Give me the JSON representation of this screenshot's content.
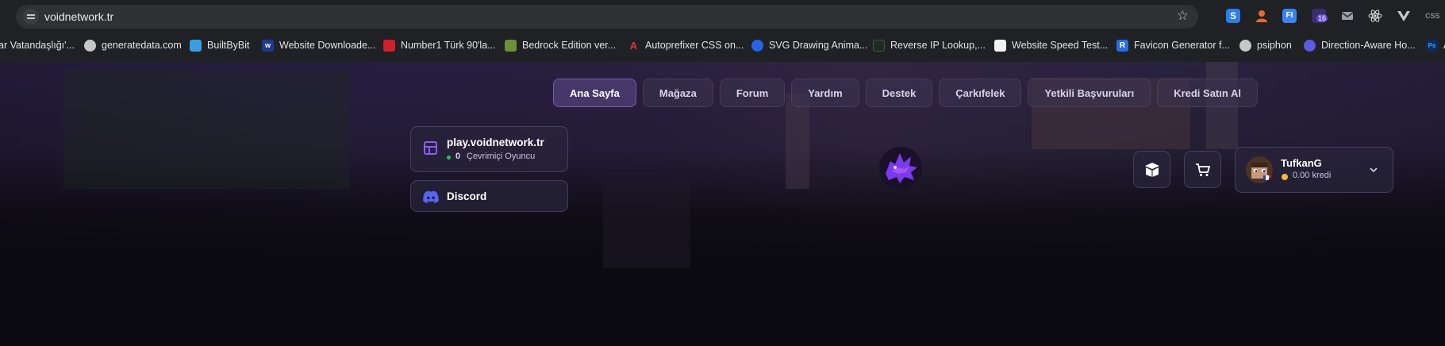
{
  "browser": {
    "url": "voidnetwork.tr",
    "extension_badge": "16",
    "extensions": [
      {
        "icon": "s-extension-icon",
        "color": "#2b7de9"
      },
      {
        "icon": "user-extension-icon",
        "color": "#e86b2e"
      },
      {
        "icon": "font-extension-icon",
        "color": "#3b82f6"
      },
      {
        "icon": "badge-extension-icon",
        "color": "#6d4bd8"
      },
      {
        "icon": "mail-extension-icon",
        "color": "#9aa0a6"
      },
      {
        "icon": "react-extension-icon",
        "color": "#e3e3e3"
      },
      {
        "icon": "vue-extension-icon",
        "color": "#c7c7c7"
      },
      {
        "icon": "css-extension-icon",
        "color": "#8a8a8a"
      }
    ],
    "bookmarks": [
      {
        "label": "ar Vatandaşlığı'...",
        "icon": "globe-icon",
        "color": "#8a8a8a"
      },
      {
        "label": "generatedata.com",
        "icon": "globe-icon",
        "color": "#c7c7c7"
      },
      {
        "label": "BuiltByBit",
        "icon": "cube-icon",
        "color": "#3b9ce0"
      },
      {
        "label": "Website Downloade...",
        "icon": "w-icon",
        "color": "#1e3a8a"
      },
      {
        "label": "Number1 Türk 90'la...",
        "icon": "radio-icon",
        "color": "#d0202a"
      },
      {
        "label": "Bedrock Edition ver...",
        "icon": "block-icon",
        "color": "#6b8f3a"
      },
      {
        "label": "Autoprefixer CSS on...",
        "icon": "autoprefixer-icon",
        "color": "#dd3735"
      },
      {
        "label": "SVG Drawing Anima...",
        "icon": "drop-icon",
        "color": "#2563eb"
      },
      {
        "label": "Reverse IP Lookup,...",
        "icon": "terminal-icon",
        "color": "#1f2a24"
      },
      {
        "label": "Website Speed Test...",
        "icon": "speed-icon",
        "color": "#f2f2f2"
      },
      {
        "label": "Favicon Generator f...",
        "icon": "r-icon",
        "color": "#2b6de0"
      },
      {
        "label": "psiphon",
        "icon": "globe-icon",
        "color": "#c7c7c7"
      },
      {
        "label": "Direction-Aware Ho...",
        "icon": "codepen-icon",
        "color": "#5b5be0"
      },
      {
        "label": "A",
        "icon": "ps-icon",
        "color": "#0f2a57"
      }
    ]
  },
  "nav": {
    "items": [
      "Ana Sayfa",
      "Mağaza",
      "Forum",
      "Yardım",
      "Destek",
      "Çarkıfelek",
      "Yetkili Başvuruları",
      "Kredi Satın Al"
    ],
    "active_index": 0
  },
  "server": {
    "host": "play.voidnetwork.tr",
    "online_count": "0",
    "online_label": "Çevrimiçi Oyuncu"
  },
  "discord": {
    "label": "Discord"
  },
  "user": {
    "name": "TufkanG",
    "credit": "0.00 kredi"
  },
  "colors": {
    "accent": "#8b5cf6",
    "discord": "#5865f2",
    "online": "#22c55e",
    "coin": "#f5b93d"
  }
}
